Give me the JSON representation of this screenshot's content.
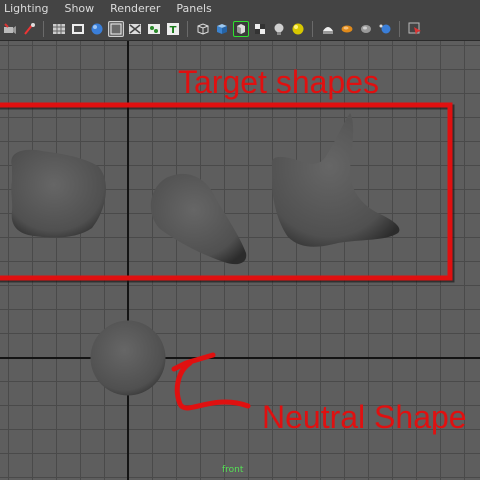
{
  "menubar": {
    "items": [
      {
        "id": "lighting",
        "label": "Lighting"
      },
      {
        "id": "show",
        "label": "Show"
      },
      {
        "id": "renderer",
        "label": "Renderer"
      },
      {
        "id": "panels",
        "label": "Panels"
      }
    ]
  },
  "toolbar": {
    "icons": [
      "select-camera-icon",
      "bookmark-icon",
      "grid-icon",
      "film-gate-icon",
      "sphere-shaded-icon",
      "wireframe-icon",
      "xray-icon",
      "texture-icon",
      "hud-text-icon",
      "cube-wireframe-icon",
      "cube-shaded-icon",
      "isolate-select-icon",
      "checker-icon",
      "light-bulb-icon",
      "sphere-icon",
      "bulb-icon",
      "cylinder-icon",
      "ellipse-icon",
      "cursor-icon"
    ]
  },
  "viewport": {
    "camera": "front",
    "annotations": {
      "target": "Target shapes",
      "neutral": "Neutral Shape"
    }
  },
  "colors": {
    "annotation": "#e01010",
    "viewport_bg": "#5e5e5e",
    "grid_line": "#4a4a4a",
    "axis_line": "#141414"
  }
}
